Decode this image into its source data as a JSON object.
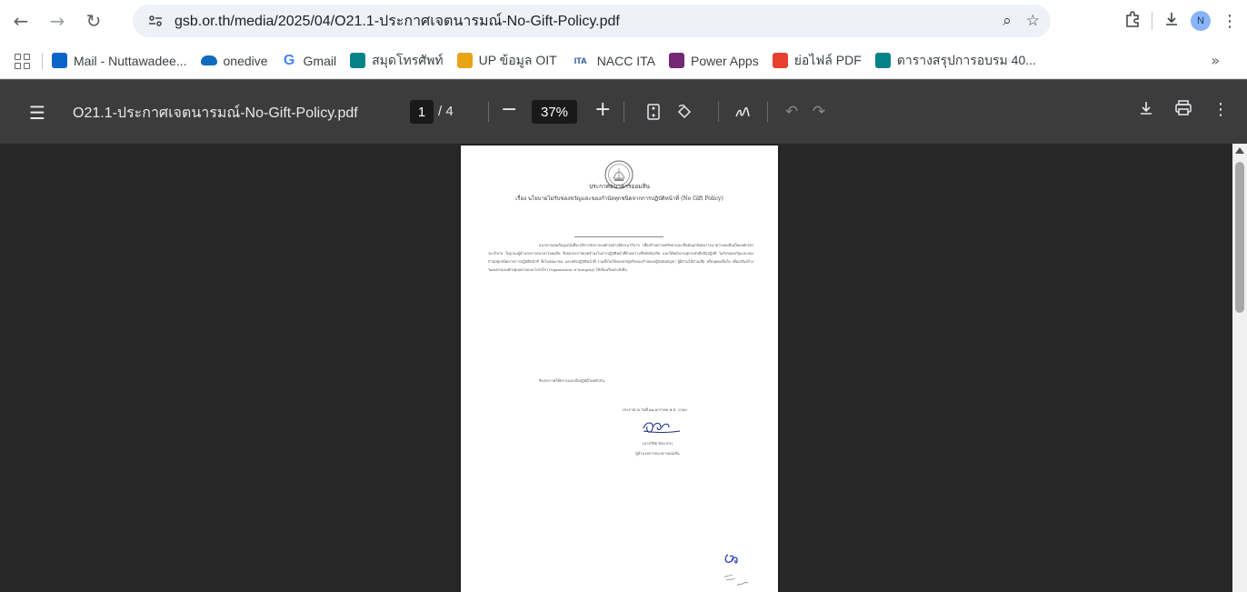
{
  "browser": {
    "url": "gsb.or.th/media/2025/04/O21.1-ประกาศเจตนารมณ์-No-Gift-Policy.pdf",
    "profile_initial": "N"
  },
  "bookmarks": [
    {
      "label": "Mail - Nuttawadee...",
      "icon": "outlook-icon",
      "color": "#0a64c8"
    },
    {
      "label": "onedive",
      "icon": "onedrive-cloud-icon",
      "color": "#0f6cbd"
    },
    {
      "label": "Gmail",
      "icon": "google-icon",
      "color": "#4285f4"
    },
    {
      "label": "สมุดโทรศัพท์",
      "icon": "sharepoint-icon",
      "color": "#038387"
    },
    {
      "label": "UP ข้อมูล OIT",
      "icon": "up-oit-icon",
      "color": "#e8a317"
    },
    {
      "label": "NACC ITA",
      "icon": "ita-icon",
      "color": "#1f4e9e"
    },
    {
      "label": "Power Apps",
      "icon": "power-apps-icon",
      "color": "#742774"
    },
    {
      "label": "ย่อไฟล์ PDF",
      "icon": "pdf-compress-icon",
      "color": "#e63f2f"
    },
    {
      "label": "ตารางสรุปการอบรม 40...",
      "icon": "sharepoint-icon",
      "color": "#038387"
    }
  ],
  "pdf": {
    "filename": "O21.1-ประกาศเจตนารมณ์-No-Gift-Policy.pdf",
    "current_page": "1",
    "total_pages": "/ 4",
    "zoom": "37%"
  },
  "document": {
    "heading": "ประกาศธนาคารออมสิน",
    "subject": "เรื่อง นโยบายไม่รับของขวัญและของกำนัลทุกชนิดจากการปฏิบัติหน้าที่ (No Gift Policy)",
    "body": "ธนาคารออมสินมุ่งเน้นที่จะบริหารจัดการองค์กรอย่างมีธรรมาภิบาล เพื่อสร้างความศรัทธาและเชื่อมั่นแก่สังคมว่าธนาคารออมสินเป็นองค์กรธรรมาภิบาล ในฐานะผู้อำนวยการธนาคารออมสิน จึงขอประกาศเจตจำนงในการปฏิบัติหน้าที่ด้วยความซื่อสัตย์สุจริต และให้พนักงานทุกระดับยึดถือปฏิบัติ ไม่รับของขวัญและของกำนัลทุกชนิดจากการปฏิบัติหน้าที่ ทั้งในขณะก่อน และหลังปฏิบัติหน้าที่ รวมทั้งไม่ให้ของขวัญหรือของกำนัลแก่ผู้บังคับบัญชา ผู้มีส่วนได้ส่วนเสีย หรือบุคคลอื่นใด เพื่อเสริมสร้างวัฒนธรรมองค์กรคุณธรรมและโปร่งใส (Organization of Integrity) ให้เข้มแข็งและยั่งยืน",
    "closing": "จึงประกาศให้ทราบและถือปฏิบัติโดยทั่วกัน",
    "date": "ประกาศ ณ วันที่ ๒๑ มกราคม พ.ศ. 2568",
    "signer_name": "(นายวิทัย รัตนากร)",
    "signer_title": "ผู้อำนวยการธนาคารออมสิน"
  },
  "colors": {
    "toolbar": "#3c3c3c",
    "viewer_bg": "#282828",
    "omnibox": "#eef1f7"
  }
}
